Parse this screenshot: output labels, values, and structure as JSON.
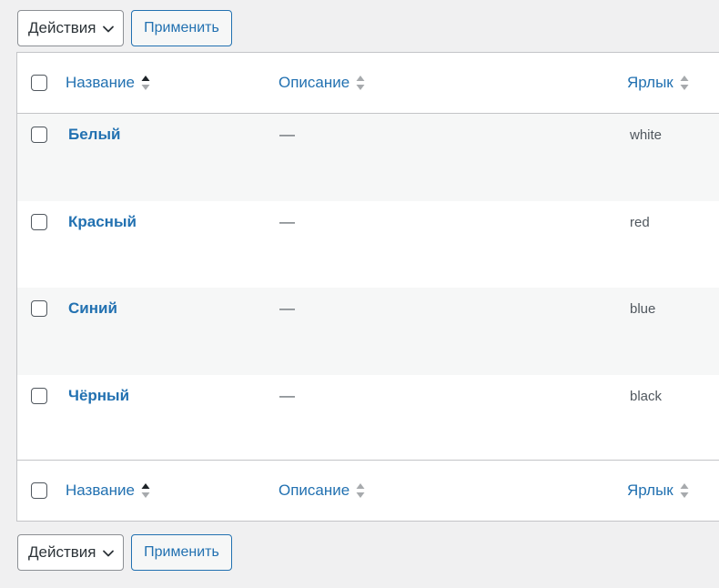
{
  "bulk_actions_top": {
    "select_value": "Действия",
    "apply_label": "Применить"
  },
  "bulk_actions_bottom": {
    "select_value": "Действия",
    "apply_label": "Применить"
  },
  "columns": {
    "name": "Название",
    "description": "Описание",
    "slug": "Ярлык"
  },
  "rows": [
    {
      "name": "Белый",
      "description": "—",
      "slug": "white"
    },
    {
      "name": "Красный",
      "description": "—",
      "slug": "red"
    },
    {
      "name": "Синий",
      "description": "—",
      "slug": "blue"
    },
    {
      "name": "Чёрный",
      "description": "—",
      "slug": "black"
    }
  ],
  "colors": {
    "link": "#2271b1",
    "border": "#c3c4c7",
    "page_bg": "#f0f0f1",
    "alt_row": "#f6f7f7"
  }
}
